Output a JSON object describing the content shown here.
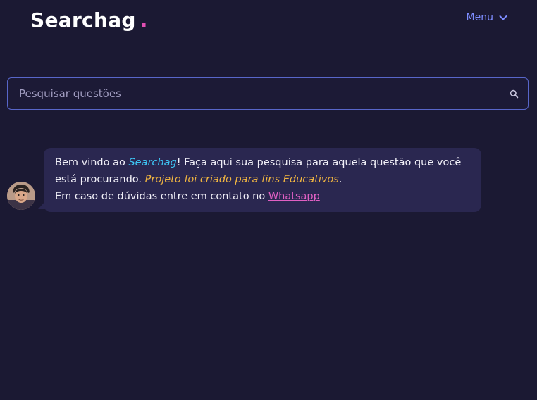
{
  "header": {
    "brand": "Searchag",
    "brand_dot": ".",
    "menu_label": "Menu",
    "menu_icon": "chevron-down-icon"
  },
  "search": {
    "placeholder": "Pesquisar questões",
    "value": "",
    "icon": "search-icon"
  },
  "chat": {
    "avatar_icon": "user-avatar",
    "message": {
      "intro": "Bem vindo ao ",
      "brand_ref": "Searchag",
      "after_brand": "! Faça aqui sua pesquisa para aquela questão que você está procurando. ",
      "educational": "Projeto foi criado para fins Educativos",
      "after_educational": ".",
      "contact_text": "Em caso de dúvidas entre em contato no ",
      "contact_link": "Whatsapp"
    }
  },
  "colors": {
    "background": "#1b1933",
    "accent": "#7d8cff",
    "brand_dot": "#e04fb3",
    "brand_ref": "#3ec7f5",
    "educational": "#f0b541",
    "link": "#e060c3"
  }
}
